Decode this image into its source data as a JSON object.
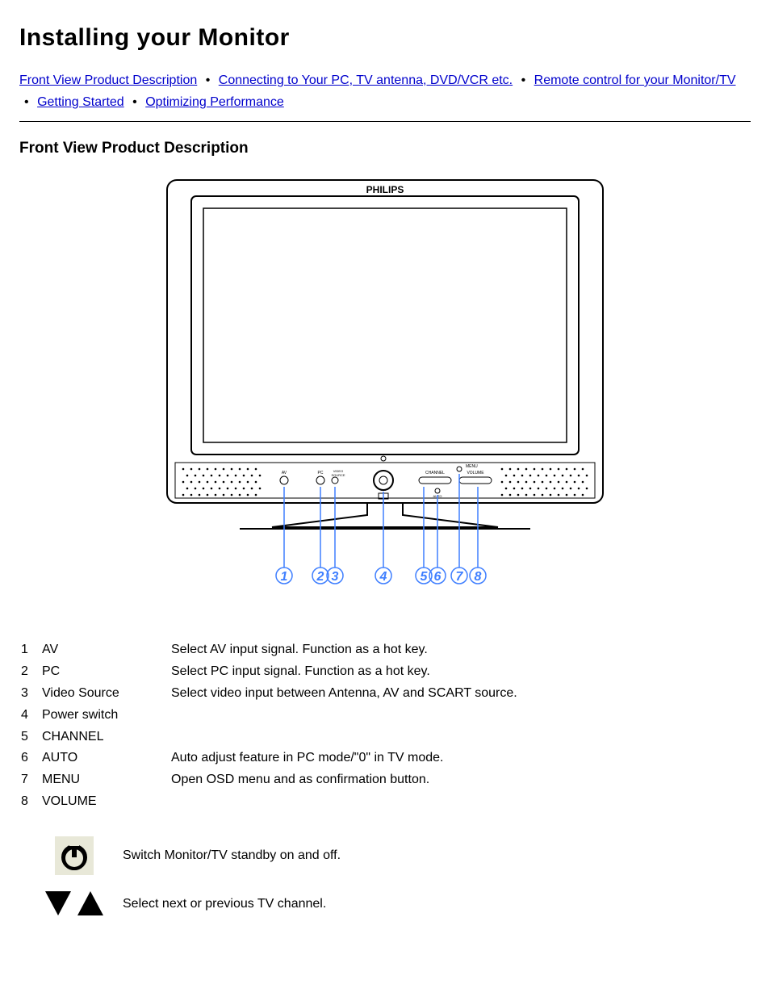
{
  "title": "Installing your Monitor",
  "nav": {
    "items": [
      {
        "label": "Front View Product Description"
      },
      {
        "label": "Connecting to Your PC, TV antenna, DVD/VCR etc."
      },
      {
        "label": "Remote control for your Monitor/TV"
      },
      {
        "label": "Getting Started"
      },
      {
        "label": "Optimizing Performance"
      }
    ],
    "separator": "•"
  },
  "section": "Front View Product Description",
  "monitor_brand": "PHILIPS",
  "legend": [
    {
      "num": "1",
      "label": "AV",
      "desc": "Select AV input signal. Function as a hot key."
    },
    {
      "num": "2",
      "label": "PC",
      "desc": "Select PC input signal. Function as a hot key."
    },
    {
      "num": "3",
      "label": "Video Source",
      "desc": "Select video input between Antenna, AV and SCART source."
    },
    {
      "num": "4",
      "label": "Power switch",
      "desc": ""
    },
    {
      "num": "5",
      "label": "CHANNEL",
      "desc": ""
    },
    {
      "num": "6",
      "label": "AUTO",
      "desc": "Auto adjust feature in PC mode/\"0\" in TV mode."
    },
    {
      "num": "7",
      "label": "MENU",
      "desc": "Open OSD menu and as confirmation button."
    },
    {
      "num": "8",
      "label": "VOLUME",
      "desc": ""
    }
  ],
  "extra": [
    {
      "icon": "power-icon",
      "text": "Switch Monitor/TV standby on and off."
    },
    {
      "icon": "triangles-icon",
      "text": "Select next or previous TV channel."
    }
  ]
}
